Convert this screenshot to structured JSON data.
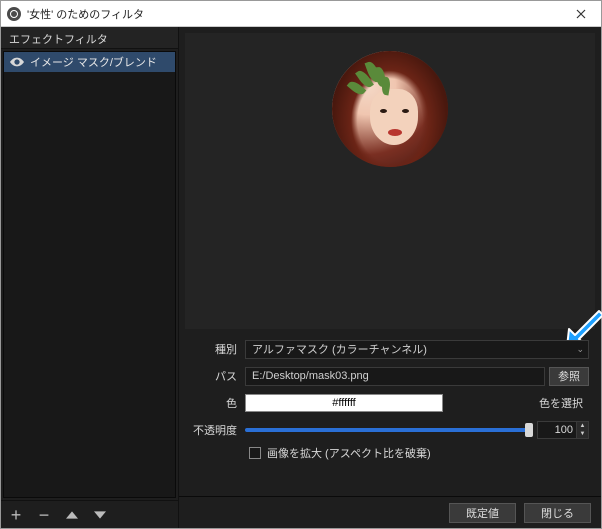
{
  "window": {
    "title": "'女性' のためのフィルタ",
    "close_icon": "close-icon"
  },
  "sidebar": {
    "header": "エフェクトフィルタ",
    "items": [
      {
        "label": "イメージ マスク/ブレンド",
        "visible": true
      }
    ],
    "footer": {
      "add": "+",
      "remove": "−",
      "up": "caret-up",
      "down": "caret-down"
    }
  },
  "form": {
    "type_label": "種別",
    "type_value": "アルファマスク (カラーチャンネル)",
    "path_label": "パス",
    "path_value": "E:/Desktop/mask03.png",
    "browse_label": "参照",
    "color_label": "色",
    "color_hex": "#ffffff",
    "color_pick_label": "色を選択",
    "opacity_label": "不透明度",
    "opacity_value": "100",
    "stretch_label": "画像を拡大 (アスペクト比を破棄)"
  },
  "footer": {
    "defaults": "既定値",
    "close": "閉じる"
  }
}
